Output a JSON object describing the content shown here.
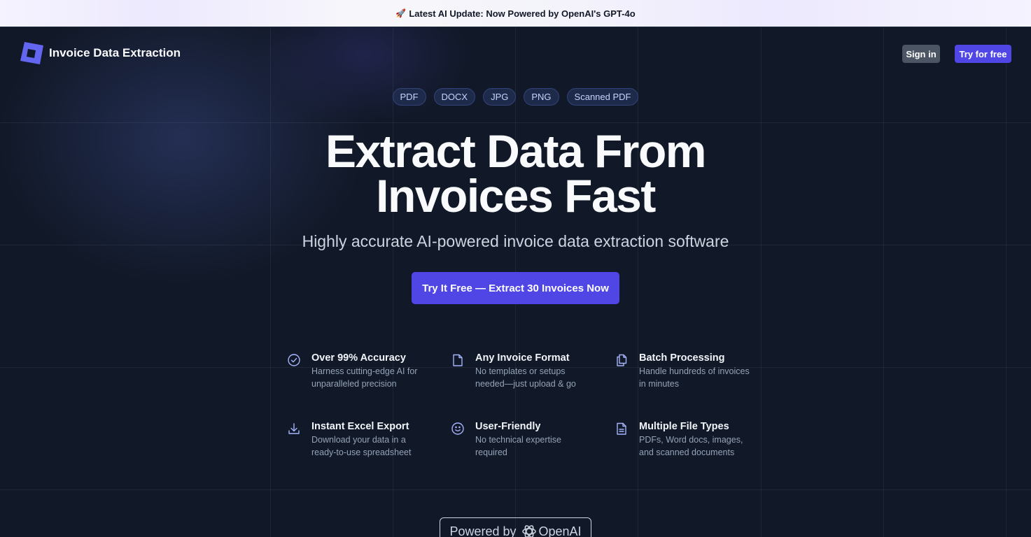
{
  "announcement": {
    "icon": "rocket-icon",
    "text": "Latest AI Update: Now Powered by OpenAI's GPT-4o"
  },
  "navbar": {
    "brand": "Invoice Data Extraction",
    "sign_in": "Sign in",
    "try_free": "Try for free"
  },
  "formats": [
    "PDF",
    "DOCX",
    "JPG",
    "PNG",
    "Scanned PDF"
  ],
  "hero": {
    "title_line1": "Extract Data From",
    "title_line2": "Invoices Fast",
    "subtitle": "Highly accurate AI-powered invoice data extraction software",
    "cta": "Try It Free — Extract 30 Invoices Now"
  },
  "features": [
    {
      "icon": "check-circle-icon",
      "title": "Over 99% Accuracy",
      "desc": "Harness cutting-edge AI for unparalleled precision"
    },
    {
      "icon": "document-icon",
      "title": "Any Invoice Format",
      "desc": "No templates or setups needed—just upload & go"
    },
    {
      "icon": "documents-stack-icon",
      "title": "Batch Processing",
      "desc": "Handle hundreds of invoices in minutes"
    },
    {
      "icon": "download-icon",
      "title": "Instant Excel Export",
      "desc": "Download your data in a ready-to-use spreadsheet"
    },
    {
      "icon": "smiley-icon",
      "title": "User-Friendly",
      "desc": "No technical expertise required"
    },
    {
      "icon": "file-text-icon",
      "title": "Multiple File Types",
      "desc": "PDFs, Word docs, images, and scanned documents"
    }
  ],
  "powered_by": {
    "prefix": "Powered by",
    "brand": "OpenAI",
    "icon": "openai-logo-icon"
  },
  "colors": {
    "accent": "#4f46e5",
    "background": "#111827",
    "chip_text": "#c7d2fe"
  }
}
